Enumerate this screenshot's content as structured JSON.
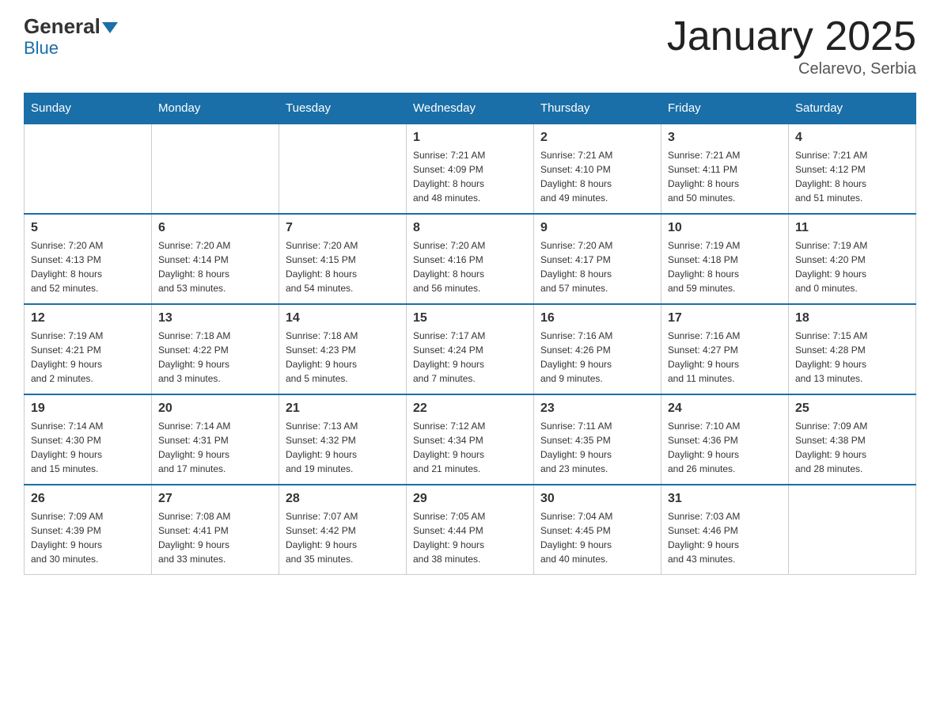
{
  "header": {
    "logo": {
      "general": "General",
      "blue": "Blue"
    },
    "title": "January 2025",
    "location": "Celarevo, Serbia"
  },
  "weekdays": [
    "Sunday",
    "Monday",
    "Tuesday",
    "Wednesday",
    "Thursday",
    "Friday",
    "Saturday"
  ],
  "weeks": [
    [
      {
        "day": "",
        "info": ""
      },
      {
        "day": "",
        "info": ""
      },
      {
        "day": "",
        "info": ""
      },
      {
        "day": "1",
        "info": "Sunrise: 7:21 AM\nSunset: 4:09 PM\nDaylight: 8 hours\nand 48 minutes."
      },
      {
        "day": "2",
        "info": "Sunrise: 7:21 AM\nSunset: 4:10 PM\nDaylight: 8 hours\nand 49 minutes."
      },
      {
        "day": "3",
        "info": "Sunrise: 7:21 AM\nSunset: 4:11 PM\nDaylight: 8 hours\nand 50 minutes."
      },
      {
        "day": "4",
        "info": "Sunrise: 7:21 AM\nSunset: 4:12 PM\nDaylight: 8 hours\nand 51 minutes."
      }
    ],
    [
      {
        "day": "5",
        "info": "Sunrise: 7:20 AM\nSunset: 4:13 PM\nDaylight: 8 hours\nand 52 minutes."
      },
      {
        "day": "6",
        "info": "Sunrise: 7:20 AM\nSunset: 4:14 PM\nDaylight: 8 hours\nand 53 minutes."
      },
      {
        "day": "7",
        "info": "Sunrise: 7:20 AM\nSunset: 4:15 PM\nDaylight: 8 hours\nand 54 minutes."
      },
      {
        "day": "8",
        "info": "Sunrise: 7:20 AM\nSunset: 4:16 PM\nDaylight: 8 hours\nand 56 minutes."
      },
      {
        "day": "9",
        "info": "Sunrise: 7:20 AM\nSunset: 4:17 PM\nDaylight: 8 hours\nand 57 minutes."
      },
      {
        "day": "10",
        "info": "Sunrise: 7:19 AM\nSunset: 4:18 PM\nDaylight: 8 hours\nand 59 minutes."
      },
      {
        "day": "11",
        "info": "Sunrise: 7:19 AM\nSunset: 4:20 PM\nDaylight: 9 hours\nand 0 minutes."
      }
    ],
    [
      {
        "day": "12",
        "info": "Sunrise: 7:19 AM\nSunset: 4:21 PM\nDaylight: 9 hours\nand 2 minutes."
      },
      {
        "day": "13",
        "info": "Sunrise: 7:18 AM\nSunset: 4:22 PM\nDaylight: 9 hours\nand 3 minutes."
      },
      {
        "day": "14",
        "info": "Sunrise: 7:18 AM\nSunset: 4:23 PM\nDaylight: 9 hours\nand 5 minutes."
      },
      {
        "day": "15",
        "info": "Sunrise: 7:17 AM\nSunset: 4:24 PM\nDaylight: 9 hours\nand 7 minutes."
      },
      {
        "day": "16",
        "info": "Sunrise: 7:16 AM\nSunset: 4:26 PM\nDaylight: 9 hours\nand 9 minutes."
      },
      {
        "day": "17",
        "info": "Sunrise: 7:16 AM\nSunset: 4:27 PM\nDaylight: 9 hours\nand 11 minutes."
      },
      {
        "day": "18",
        "info": "Sunrise: 7:15 AM\nSunset: 4:28 PM\nDaylight: 9 hours\nand 13 minutes."
      }
    ],
    [
      {
        "day": "19",
        "info": "Sunrise: 7:14 AM\nSunset: 4:30 PM\nDaylight: 9 hours\nand 15 minutes."
      },
      {
        "day": "20",
        "info": "Sunrise: 7:14 AM\nSunset: 4:31 PM\nDaylight: 9 hours\nand 17 minutes."
      },
      {
        "day": "21",
        "info": "Sunrise: 7:13 AM\nSunset: 4:32 PM\nDaylight: 9 hours\nand 19 minutes."
      },
      {
        "day": "22",
        "info": "Sunrise: 7:12 AM\nSunset: 4:34 PM\nDaylight: 9 hours\nand 21 minutes."
      },
      {
        "day": "23",
        "info": "Sunrise: 7:11 AM\nSunset: 4:35 PM\nDaylight: 9 hours\nand 23 minutes."
      },
      {
        "day": "24",
        "info": "Sunrise: 7:10 AM\nSunset: 4:36 PM\nDaylight: 9 hours\nand 26 minutes."
      },
      {
        "day": "25",
        "info": "Sunrise: 7:09 AM\nSunset: 4:38 PM\nDaylight: 9 hours\nand 28 minutes."
      }
    ],
    [
      {
        "day": "26",
        "info": "Sunrise: 7:09 AM\nSunset: 4:39 PM\nDaylight: 9 hours\nand 30 minutes."
      },
      {
        "day": "27",
        "info": "Sunrise: 7:08 AM\nSunset: 4:41 PM\nDaylight: 9 hours\nand 33 minutes."
      },
      {
        "day": "28",
        "info": "Sunrise: 7:07 AM\nSunset: 4:42 PM\nDaylight: 9 hours\nand 35 minutes."
      },
      {
        "day": "29",
        "info": "Sunrise: 7:05 AM\nSunset: 4:44 PM\nDaylight: 9 hours\nand 38 minutes."
      },
      {
        "day": "30",
        "info": "Sunrise: 7:04 AM\nSunset: 4:45 PM\nDaylight: 9 hours\nand 40 minutes."
      },
      {
        "day": "31",
        "info": "Sunrise: 7:03 AM\nSunset: 4:46 PM\nDaylight: 9 hours\nand 43 minutes."
      },
      {
        "day": "",
        "info": ""
      }
    ]
  ]
}
